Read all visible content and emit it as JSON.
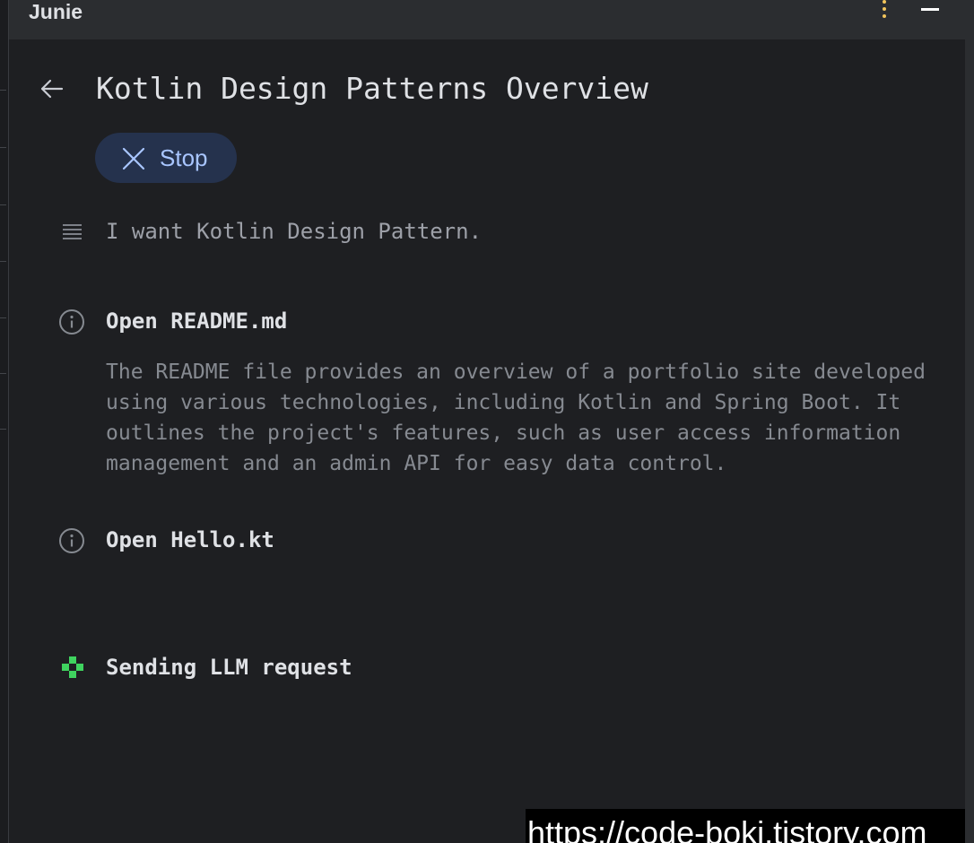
{
  "app": {
    "title": "Junie"
  },
  "header": {
    "icons": [
      "more-vertical-icon",
      "minimize-icon"
    ],
    "more_color": "#f2c55c"
  },
  "task": {
    "title": "Kotlin Design Patterns Overview",
    "stop_label": "Stop",
    "stop_colors": {
      "background": "#25324d",
      "text": "#a9c6ff"
    }
  },
  "steps": [
    {
      "icon": "prompt-lines-icon",
      "text": "I want Kotlin Design Pattern."
    },
    {
      "icon": "info-icon",
      "title": "Open README.md",
      "description": "The README file provides an overview of a portfolio site developed using various technologies, including Kotlin and Spring Boot. It outlines the project's features, such as user access information management and an admin API for easy data control."
    },
    {
      "icon": "info-icon",
      "title": "Open Hello.kt"
    },
    {
      "icon": "loading-spinner-icon",
      "title": "Sending LLM request",
      "icon_color": "#3fd35f"
    }
  ],
  "watermark": {
    "text": "https://code-boki.tistory.com"
  }
}
